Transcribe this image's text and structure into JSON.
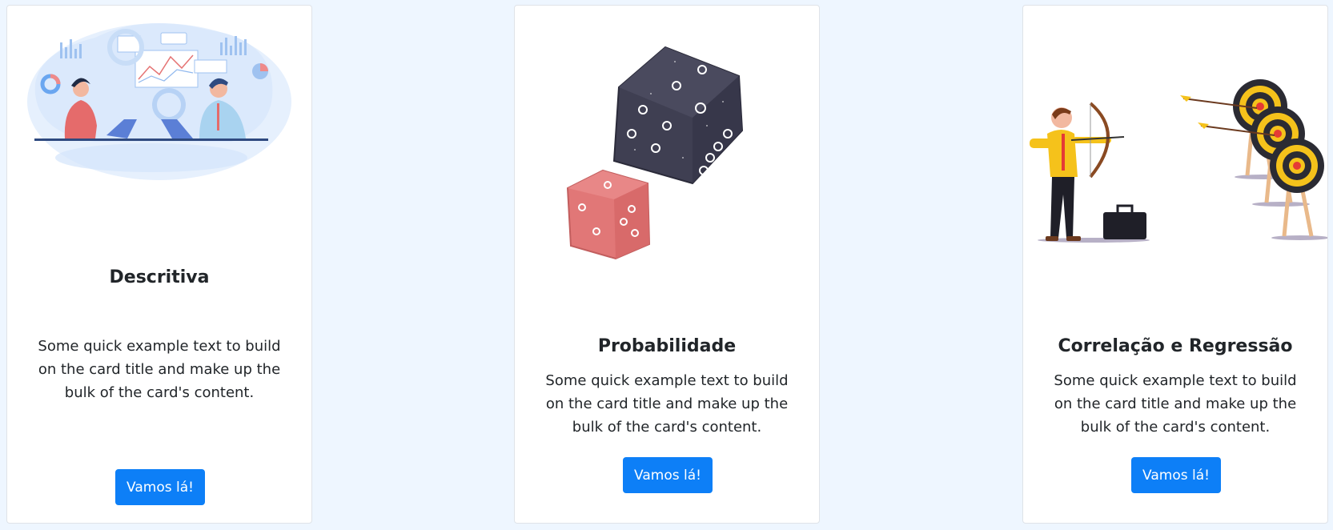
{
  "cards": [
    {
      "title": "Descritiva",
      "text": "Some quick example text to build on the card title and make up the bulk of the card's content.",
      "button": "Vamos lá!",
      "illustration": "business-analytics-illustration"
    },
    {
      "title": "Probabilidade",
      "text": "Some quick example text to build on the card title and make up the bulk of the card's content.",
      "button": "Vamos lá!",
      "illustration": "dice-illustration"
    },
    {
      "title": "Correlação e Regressão",
      "text": "Some quick example text to build on the card title and make up the bulk of the card's content.",
      "button": "Vamos lá!",
      "illustration": "archer-targets-illustration"
    }
  ],
  "colors": {
    "page_background": "#eef6ff",
    "card_background": "#ffffff",
    "button": "#0d7ff7",
    "button_text": "#ffffff"
  }
}
